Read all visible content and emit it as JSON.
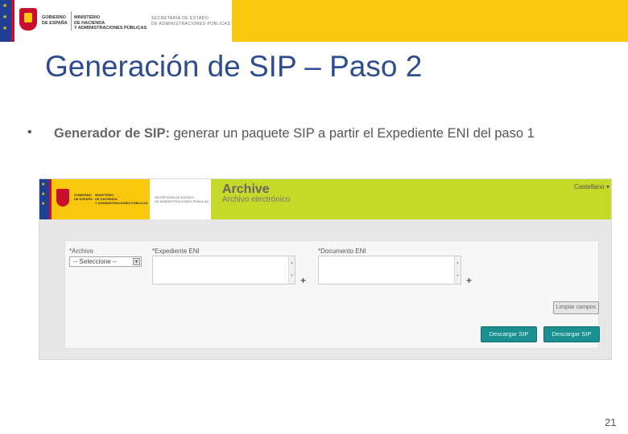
{
  "banner": {
    "gov_line1": "GOBIERNO",
    "gov_line2": "DE ESPAÑA",
    "ministry_line1": "MINISTERIO",
    "ministry_line2": "DE HACIENDA",
    "ministry_line3": "Y ADMINISTRACIONES PÚBLICAS",
    "secretaria_line1": "SECRETARÍA DE ESTADO",
    "secretaria_line2": "DE ADMINISTRACIONES PÚBLICAS",
    "colors": {
      "yellow": "#f9c80e",
      "eu_blue": "#1f3f94",
      "red": "#c8102e"
    }
  },
  "slide": {
    "title": "Generación de SIP – Paso 2",
    "bullet_bold": "Generador de SIP:",
    "bullet_text": " generar un paquete SIP a partir el Expediente ENI del paso 1",
    "page_number": "21",
    "title_color": "#2e4d8f"
  },
  "screenshot": {
    "header": {
      "app_title": "Archive",
      "app_subtitle": "Archivo electrónico",
      "language_selector": "Castellano ▾",
      "header_color": "#c5d928"
    },
    "form": {
      "archivo_label": "*Archivo",
      "archivo_select_value": "-- Seleccione --",
      "expediente_label": "*Expediente ENI",
      "documento_label": "*Documento ENI",
      "add_icon": "+",
      "clear_button": "Limpiar campos",
      "download_sip_button_1": "Descargar SIP",
      "download_sip_button_2": "Descargar SIP",
      "button_color": "#1c8f91"
    }
  }
}
